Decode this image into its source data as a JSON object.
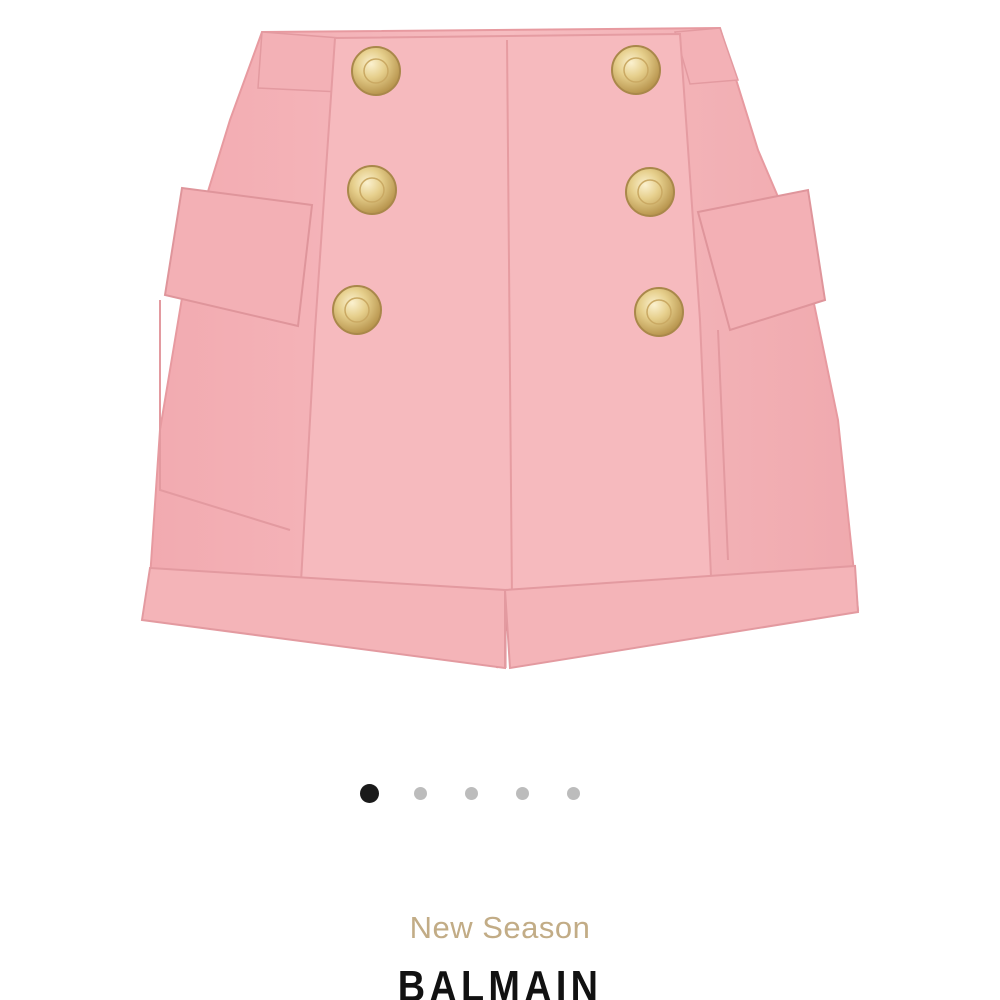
{
  "product": {
    "image_subject": "pink-high-waisted-shorts-gold-buttons",
    "colors": {
      "fabric": "#f4b3b7",
      "fabric_shadow": "#e89ea3",
      "button_gold": "#e6cf8c"
    }
  },
  "carousel": {
    "total_slides": 5,
    "active_index": 0,
    "active_color": "#1a1a1a",
    "inactive_color": "#bcbcbc"
  },
  "labels": {
    "season": "New Season",
    "brand": "BALMAIN"
  },
  "colors": {
    "season_text": "#c2ac86",
    "brand_text": "#111111",
    "background": "#ffffff"
  }
}
